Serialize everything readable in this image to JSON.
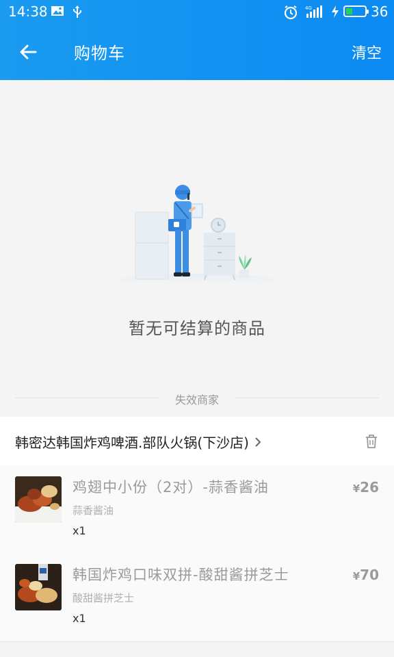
{
  "status_bar": {
    "time": "14:38",
    "network": "4G",
    "battery_percent": "36",
    "battery_level": 0.36,
    "icons": [
      "image-icon",
      "usb-icon",
      "alarm-icon",
      "signal-icon",
      "charging-icon",
      "battery-icon"
    ]
  },
  "header": {
    "title": "购物车",
    "clear_label": "清空",
    "back_icon": "back-arrow-icon"
  },
  "empty_state": {
    "message": "暂无可结算的商品"
  },
  "invalid_section": {
    "label": "失效商家",
    "store": {
      "name": "韩密达韩国炸鸡啤酒.部队火锅(下沙店)",
      "items": [
        {
          "title": "鸡翅中小份（2对）-蒜香酱油",
          "subtitle": "蒜香酱油",
          "quantity": "x1",
          "currency": "¥",
          "price": "26"
        },
        {
          "title": "韩国炸鸡口味双拼-酸甜酱拼芝士",
          "subtitle": "酸甜酱拼芝士",
          "quantity": "x1",
          "currency": "¥",
          "price": "70"
        }
      ]
    }
  },
  "colors": {
    "header_bg": "#1a9bf0",
    "battery_green": "#29d24a",
    "page_bg": "#f4f4f4"
  }
}
